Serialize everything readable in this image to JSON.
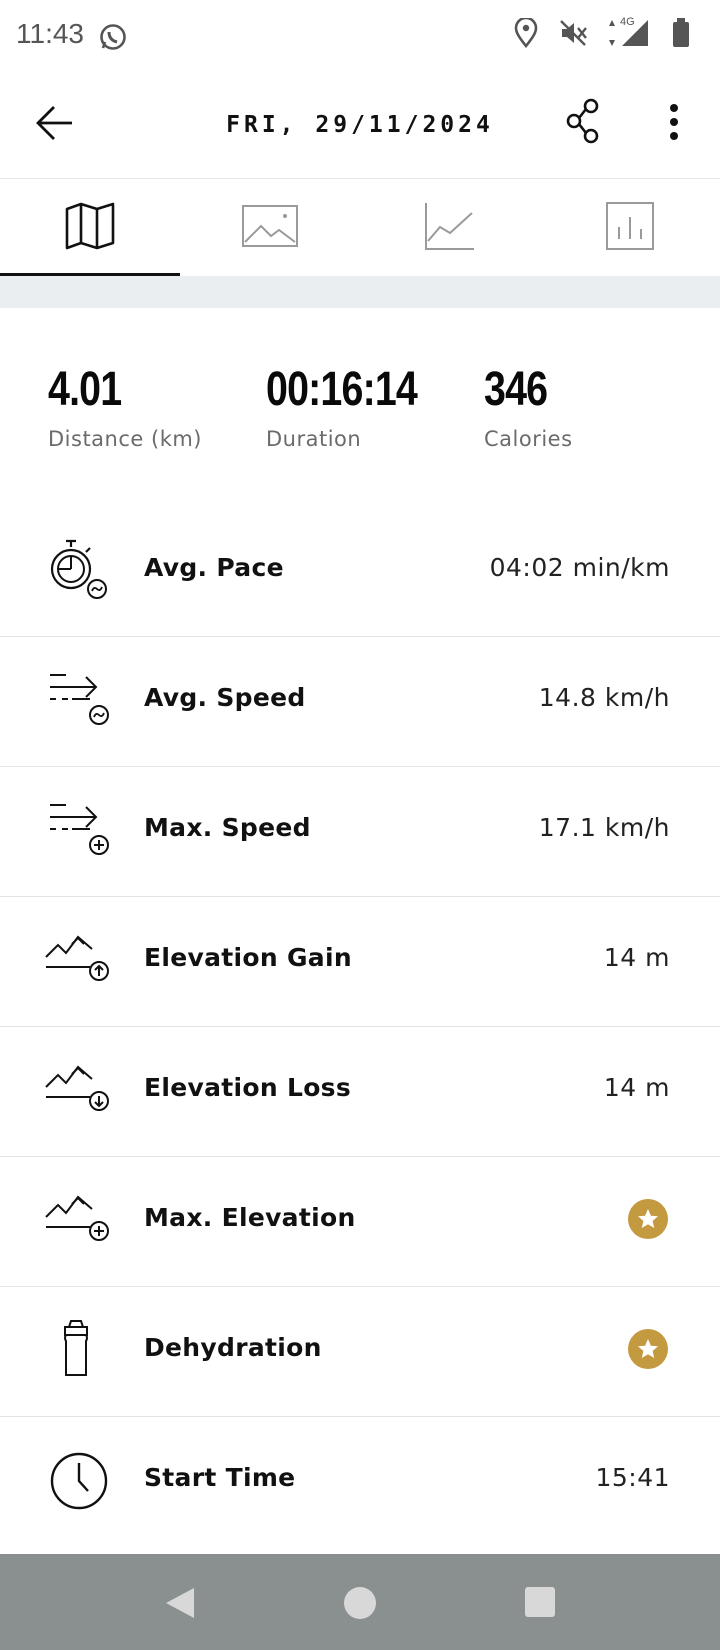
{
  "status": {
    "time": "11:43",
    "network": "4G"
  },
  "header": {
    "title": "FRI, 29/11/2024"
  },
  "tabs": [
    {
      "name": "map",
      "icon": "map-icon",
      "active": true
    },
    {
      "name": "photos",
      "icon": "image-icon",
      "active": false
    },
    {
      "name": "graphs",
      "icon": "line-chart-icon",
      "active": false
    },
    {
      "name": "splits",
      "icon": "bar-chart-icon",
      "active": false
    }
  ],
  "summary": [
    {
      "value": "4.01",
      "label": "Distance (km)"
    },
    {
      "value": "00:16:14",
      "label": "Duration"
    },
    {
      "value": "346",
      "label": "Calories"
    }
  ],
  "stats": [
    {
      "label": "Avg. Pace",
      "value": "04:02 min/km",
      "icon": "stopwatch-pace-icon"
    },
    {
      "label": "Avg. Speed",
      "value": "14.8 km/h",
      "icon": "speed-avg-icon"
    },
    {
      "label": "Max. Speed",
      "value": "17.1 km/h",
      "icon": "speed-max-icon"
    },
    {
      "label": "Elevation Gain",
      "value": "14 m",
      "icon": "elevation-gain-icon"
    },
    {
      "label": "Elevation Loss",
      "value": "14 m",
      "icon": "elevation-loss-icon"
    },
    {
      "label": "Max. Elevation",
      "value": null,
      "icon": "elevation-max-icon",
      "premium": true
    },
    {
      "label": "Dehydration",
      "value": null,
      "icon": "bottle-icon",
      "premium": true
    },
    {
      "label": "Start Time",
      "value": "15:41",
      "icon": "clock-icon"
    }
  ],
  "colors": {
    "premium_badge": "#c49a41",
    "nav_bar": "#8a9090",
    "divider_strip": "#ebeef0"
  }
}
